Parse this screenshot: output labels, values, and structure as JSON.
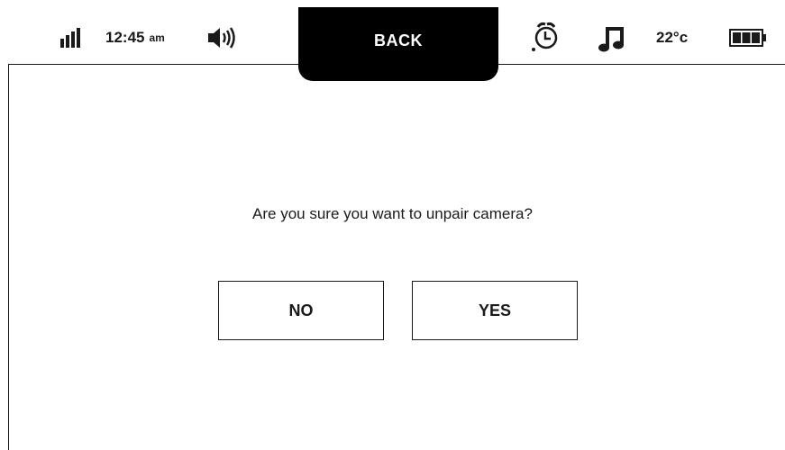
{
  "status_bar": {
    "signal_icon": "signal-bars-icon",
    "time": "12:45",
    "ampm": "am",
    "speaker_icon": "speaker-icon",
    "back_label": "BACK",
    "alarm_icon": "alarm-clock-icon",
    "music_icon": "music-note-icon",
    "temperature": "22°c",
    "battery_icon": "battery-full-icon"
  },
  "dialog": {
    "question": "Are you sure you want to unpair camera?",
    "no_label": "NO",
    "yes_label": "YES"
  },
  "colors": {
    "foreground": "#1a1a1a",
    "background": "#ffffff",
    "tab_background": "#000000"
  }
}
